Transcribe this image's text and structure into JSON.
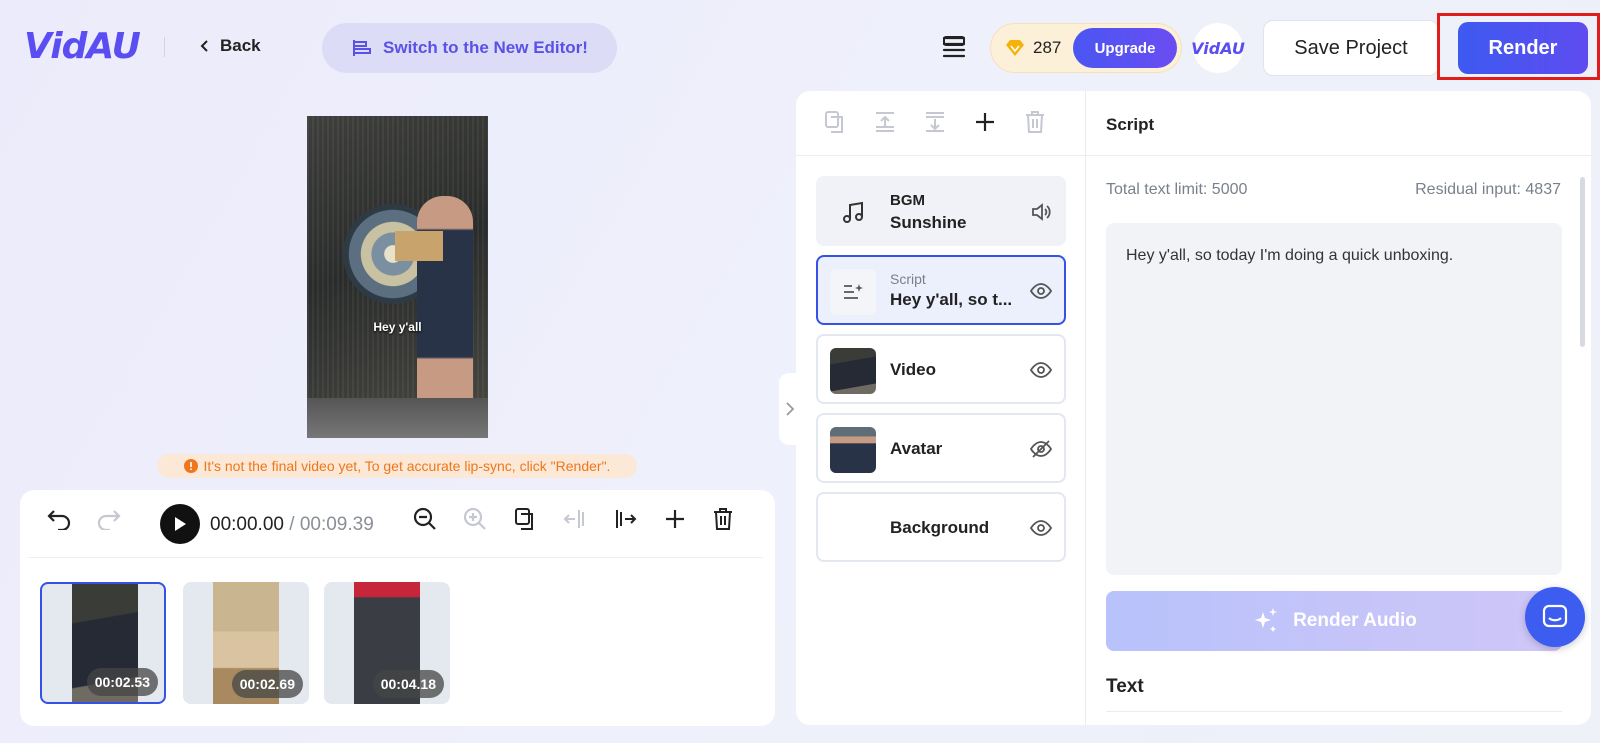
{
  "header": {
    "logo": "VidAU",
    "back_label": "Back",
    "switch_label": "Switch to the New Editor!",
    "credits": "287",
    "upgrade_label": "Upgrade",
    "avatar_logo": "VidAU",
    "save_label": "Save Project",
    "render_label": "Render"
  },
  "preview": {
    "caption": "Hey y'all",
    "warning": "It's not the final video yet, To get accurate lip-sync, click \"Render\"."
  },
  "timeline": {
    "current_time": "00:00.00",
    "separator": " / ",
    "total_time": "00:09.39",
    "clips": [
      {
        "duration": "00:02.53",
        "selected": true
      },
      {
        "duration": "00:02.69",
        "selected": false
      },
      {
        "duration": "00:04.18",
        "selected": false
      }
    ]
  },
  "layers": [
    {
      "label": "BGM",
      "sub": "Sunshine",
      "icon": "music-note-icon",
      "status_icon": "speaker-icon"
    },
    {
      "label": "Script",
      "sub": "Hey y'all, so t...",
      "icon": "script-sparkle-icon",
      "status_icon": "eye-icon"
    },
    {
      "label": "Video",
      "icon": "video-thumbnail",
      "status_icon": "eye-icon"
    },
    {
      "label": "Avatar",
      "icon": "avatar-thumbnail",
      "status_icon": "eye-off-icon"
    },
    {
      "label": "Background",
      "status_icon": "eye-icon"
    }
  ],
  "script_panel": {
    "title": "Script",
    "total_limit": "Total text limit: 5000",
    "residual": "Residual input: 4837",
    "text": "Hey y'all, so today I'm doing a quick unboxing.",
    "render_audio_label": "Render Audio",
    "text_section": "Text"
  },
  "colors": {
    "accent": "#3552e4",
    "render": "#4a56f2",
    "warning": "#f0761d",
    "highlight_box": "#e21b1b"
  }
}
